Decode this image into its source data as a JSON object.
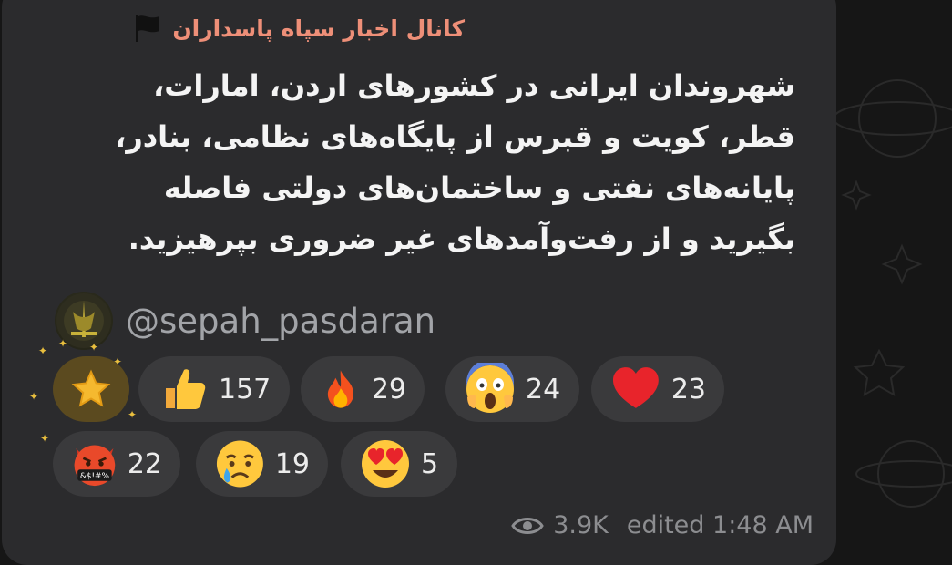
{
  "channel": {
    "name": "کانال اخبار سپاه پاسداران",
    "flag_icon": "black-flag-icon",
    "name_color": "#ee8f78"
  },
  "message": {
    "lines": [
      "شهروندان ایرانی در کشورهای اردن، امارات،",
      "قطر، کویت و قبرس از پایگاه‌های نظامی، بنادر،",
      "پایانه‌های نفتی و ساختمان‌های دولتی فاصله",
      "بگیرید و از رفت‌وآمدهای غیر ضروری بپرهیزید."
    ],
    "signature_handle": "@sepah_pasdaran"
  },
  "reactions": {
    "paid_star_icon": "star-icon",
    "items": [
      {
        "emoji": "thumbs-up-icon",
        "count": "157"
      },
      {
        "emoji": "fire-icon",
        "count": "29"
      },
      {
        "emoji": "screaming-face-icon",
        "count": "24"
      },
      {
        "emoji": "red-heart-icon",
        "count": "23"
      },
      {
        "emoji": "cursing-face-icon",
        "count": "22"
      },
      {
        "emoji": "crying-face-icon",
        "count": "19"
      },
      {
        "emoji": "heart-eyes-icon",
        "count": "5"
      }
    ]
  },
  "meta": {
    "views": "3.9K",
    "edited_time": "edited 1:48 AM",
    "views_icon": "eye-icon"
  },
  "colors": {
    "bubble": "#2b2b2d",
    "background": "#161616",
    "reaction_pill": "#3a3a3c",
    "star_pill": "#5b4a1f"
  }
}
